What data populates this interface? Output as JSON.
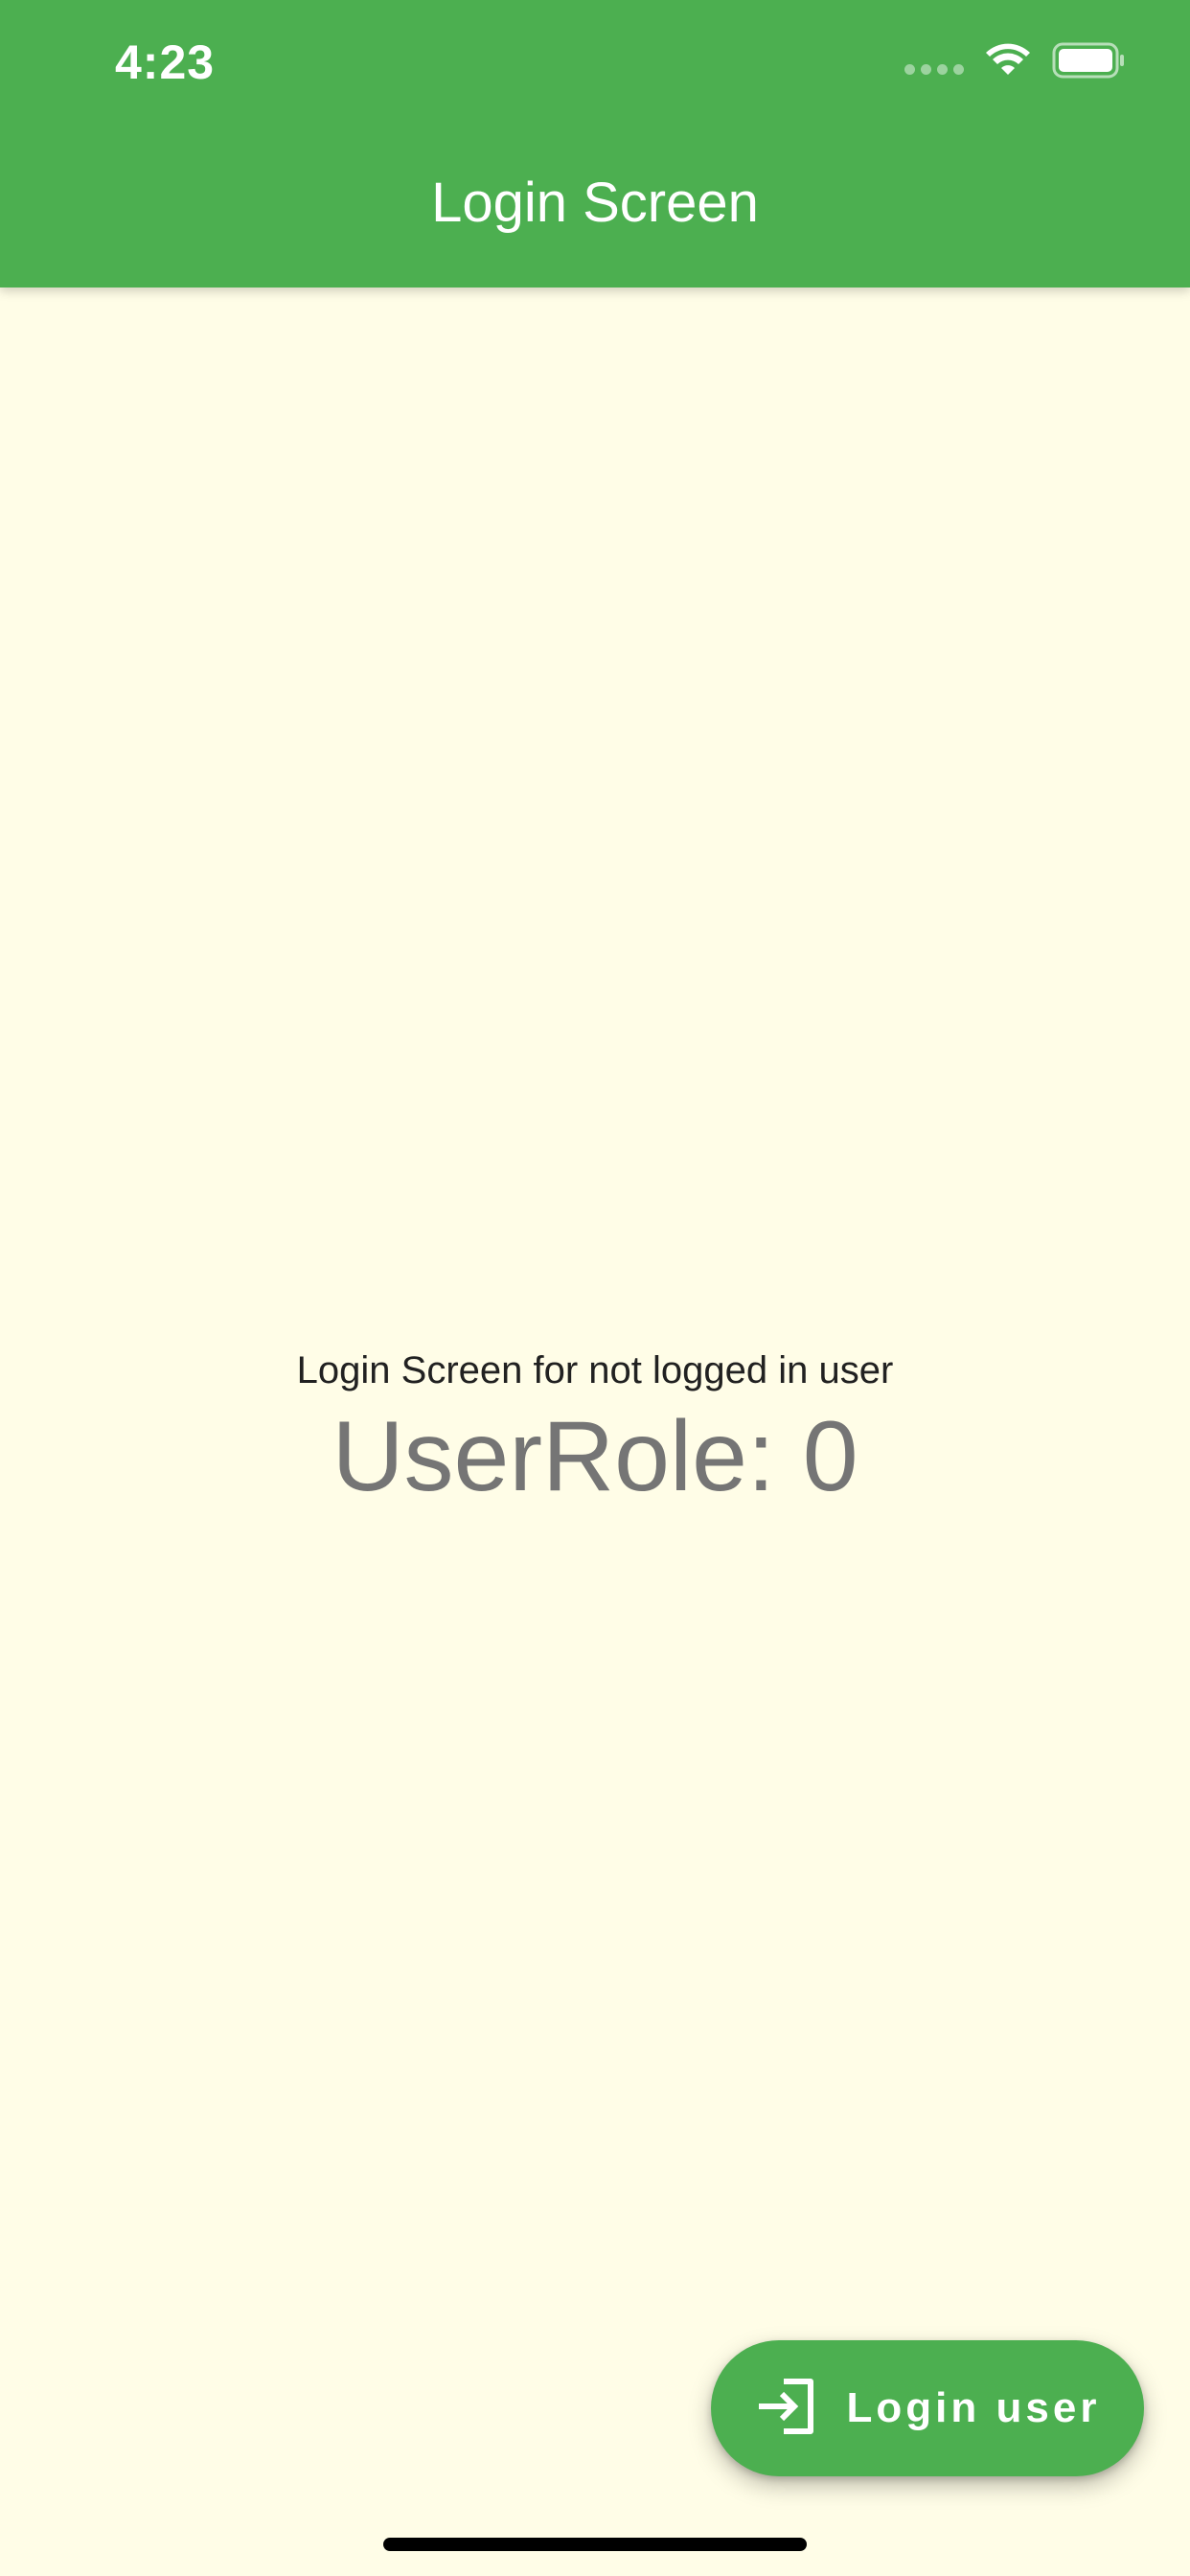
{
  "status_bar": {
    "time": "4:23",
    "icons": [
      "signal-dots-icon",
      "wifi-icon",
      "battery-icon"
    ]
  },
  "app_bar": {
    "title": "Login Screen",
    "color": "#4CAF50"
  },
  "main": {
    "subtitle": "Login Screen for not logged in user",
    "role_text": "UserRole: 0",
    "background": "#FFFDE7"
  },
  "fab": {
    "label": "Login user",
    "icon": "login-icon",
    "color": "#4CAF50"
  }
}
